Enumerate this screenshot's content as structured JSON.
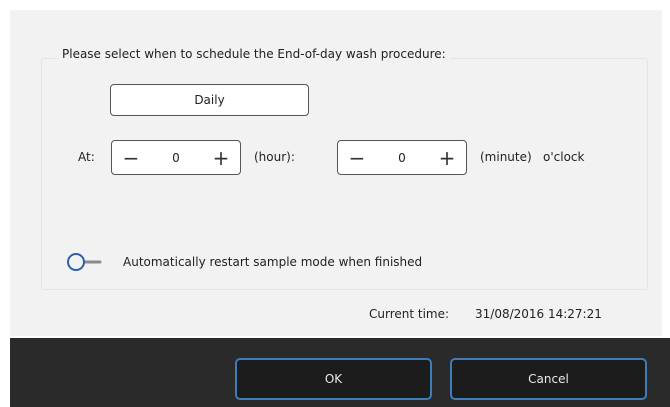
{
  "dialog": {
    "prompt": "Please select when to schedule the End-of-day wash procedure:",
    "frequency": "Daily",
    "at_label": "At:",
    "hour": {
      "value": "0",
      "unit_label": "(hour):"
    },
    "minute": {
      "value": "0",
      "unit_label": "(minute)"
    },
    "oclock_label": "o'clock",
    "stepper": {
      "minus_symbol": "−",
      "plus_symbol": "+"
    },
    "auto_restart": {
      "label": "Automatically restart sample mode when finished",
      "enabled": false
    },
    "current_time_label": "Current time:",
    "current_time_value": "31/08/2016 14:27:21"
  },
  "footer": {
    "ok_label": "OK",
    "cancel_label": "Cancel"
  },
  "colors": {
    "panel_bg": "#f2f2f2",
    "footer_bg": "#2a2a2a",
    "accent_blue": "#3f7db8",
    "toggle_blue": "#2f5fa8"
  },
  "icons": {
    "toggle": "toggle-off-icon"
  }
}
